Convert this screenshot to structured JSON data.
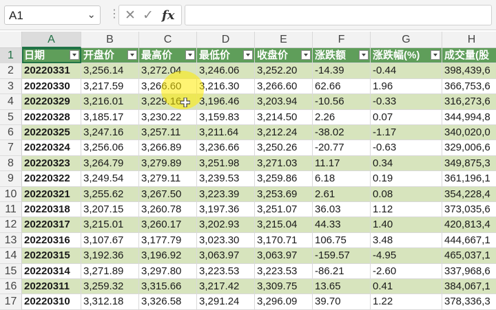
{
  "formula_bar": {
    "name_box": "A1",
    "dropdown_icon": "chevron-down-icon",
    "cancel_icon": "x-icon",
    "enter_icon": "check-icon",
    "fx_label": "fx",
    "formula": ""
  },
  "grid": {
    "selected_cell": "A1",
    "columns": [
      "A",
      "B",
      "C",
      "D",
      "E",
      "F",
      "G",
      "H"
    ],
    "row_numbers": [
      "1",
      "2",
      "3",
      "4",
      "5",
      "6",
      "7",
      "8",
      "9",
      "10",
      "11",
      "12",
      "13",
      "14",
      "15",
      "16",
      "17"
    ],
    "headers": [
      "日期",
      "开盘价",
      "最高价",
      "最低价",
      "收盘价",
      "涨跌额",
      "涨跌幅(%)",
      "成交量(股"
    ],
    "rows": [
      [
        "20220331",
        "3,256.14",
        "3,272.04",
        "3,246.06",
        "3,252.20",
        "-14.39",
        "-0.44",
        "398,439,6"
      ],
      [
        "20220330",
        "3,217.59",
        "3,266.60",
        "3,216.30",
        "3,266.60",
        "62.66",
        "1.96",
        "366,753,6"
      ],
      [
        "20220329",
        "3,216.01",
        "3,229.16",
        "3,196.46",
        "3,203.94",
        "-10.56",
        "-0.33",
        "316,273,6"
      ],
      [
        "20220328",
        "3,185.17",
        "3,230.22",
        "3,159.83",
        "3,214.50",
        "2.26",
        "0.07",
        "344,994,8"
      ],
      [
        "20220325",
        "3,247.16",
        "3,257.11",
        "3,211.64",
        "3,212.24",
        "-38.02",
        "-1.17",
        "340,020,0"
      ],
      [
        "20220324",
        "3,256.06",
        "3,266.89",
        "3,236.66",
        "3,250.26",
        "-20.77",
        "-0.63",
        "329,006,6"
      ],
      [
        "20220323",
        "3,264.79",
        "3,279.89",
        "3,251.98",
        "3,271.03",
        "11.17",
        "0.34",
        "349,875,3"
      ],
      [
        "20220322",
        "3,249.54",
        "3,279.11",
        "3,239.53",
        "3,259.86",
        "6.18",
        "0.19",
        "361,196,1"
      ],
      [
        "20220321",
        "3,255.62",
        "3,267.50",
        "3,223.39",
        "3,253.69",
        "2.61",
        "0.08",
        "354,228,4"
      ],
      [
        "20220318",
        "3,207.15",
        "3,260.78",
        "3,197.36",
        "3,251.07",
        "36.03",
        "1.12",
        "373,035,6"
      ],
      [
        "20220317",
        "3,215.01",
        "3,260.17",
        "3,202.93",
        "3,215.04",
        "44.33",
        "1.40",
        "420,813,4"
      ],
      [
        "20220316",
        "3,107.67",
        "3,177.79",
        "3,023.30",
        "3,170.71",
        "106.75",
        "3.48",
        "444,667,1"
      ],
      [
        "20220315",
        "3,192.36",
        "3,196.92",
        "3,063.97",
        "3,063.97",
        "-159.57",
        "-4.95",
        "465,037,1"
      ],
      [
        "20220314",
        "3,271.89",
        "3,297.80",
        "3,223.53",
        "3,223.53",
        "-86.21",
        "-2.60",
        "337,968,6"
      ],
      [
        "20220311",
        "3,259.32",
        "3,315.66",
        "3,217.42",
        "3,309.75",
        "13.65",
        "0.41",
        "384,067,1"
      ],
      [
        "20220310",
        "3,312.18",
        "3,326.58",
        "3,291.24",
        "3,296.09",
        "39.70",
        "1.22",
        "378,336,3"
      ]
    ]
  },
  "colors": {
    "header_bg": "#5f9e5a",
    "band_bg": "#d7e4bd",
    "selection": "#217346"
  }
}
